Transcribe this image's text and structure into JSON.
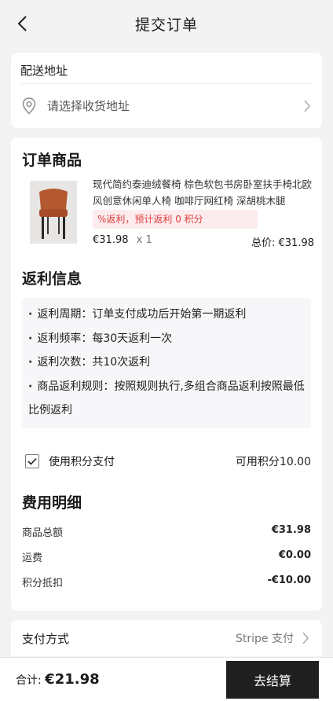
{
  "header": {
    "title": "提交订单"
  },
  "address": {
    "title": "配送地址",
    "placeholder": "请选择收货地址"
  },
  "order": {
    "title": "订单商品",
    "product": {
      "name": "现代简约泰迪绒餐椅 棕色软包书房卧室扶手椅北欧风创意休闲单人椅 咖啡厅网红椅 深胡桃木腿",
      "rebate_tag": "%返利，预计返利 0 积分",
      "price": "€31.98",
      "qty": "x 1",
      "total": "总价: €31.98"
    }
  },
  "rebate": {
    "title": "返利信息",
    "items": [
      "返利周期：订单支付成功后开始第一期返利",
      "返利频率：每30天返利一次",
      "返利次数：共10次返利",
      "商品返利规则：按照规则执行,多组合商品返利按照最低比例返利"
    ]
  },
  "points": {
    "label": "使用积分支付",
    "available": "可用积分10.00",
    "checked": true
  },
  "fees": {
    "title": "费用明细",
    "rows": [
      {
        "label": "商品总额",
        "value": "€31.98"
      },
      {
        "label": "运费",
        "value": "€0.00"
      },
      {
        "label": "积分抵扣",
        "value": "-€10.00"
      }
    ]
  },
  "payment": {
    "label": "支付方式",
    "value": "Stripe 支付"
  },
  "footer": {
    "total_label": "合计:",
    "total_amount": "€21.98",
    "checkout": "去结算"
  }
}
